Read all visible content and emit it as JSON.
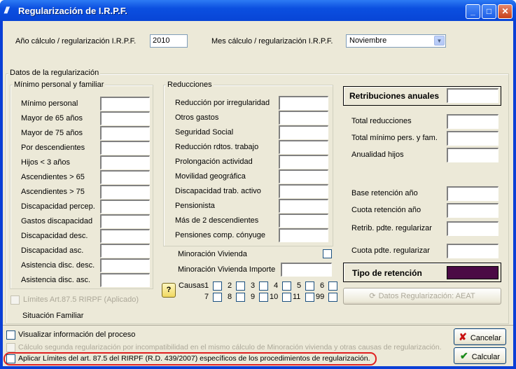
{
  "window": {
    "title": "Regularización de I.R.P.F.",
    "app_icon": "app-logo-icon"
  },
  "header": {
    "year_label": "Año cálculo / regularización I.R.P.F.",
    "year_value": "2010",
    "month_label": "Mes cálculo / regularización I.R.P.F.",
    "month_value": "Noviembre"
  },
  "datos_group": "Datos de la regularización",
  "minimo": {
    "title": "Mínimo personal y familiar",
    "items": [
      "Mínimo personal",
      "Mayor de 65 años",
      "Mayor de 75 años",
      "Por descendientes",
      "Hijos < 3 años",
      "Ascendientes > 65",
      "Ascendientes > 75",
      "Discapacidad percep.",
      "Gastos discapacidad",
      "Discapacidad desc.",
      "Discapacidad asc.",
      "Asistencia disc. desc.",
      "Asistencia disc. asc."
    ]
  },
  "reducciones": {
    "title": "Reducciones",
    "items": [
      "Reducción por irregularidad",
      "Otros gastos",
      "Seguridad Social",
      "Reducción rdtos. trabajo",
      "Prolongación actividad",
      "Movilidad geográfica",
      "Discapacidad trab. activo",
      "Pensionista",
      "Más de 2 descendientes",
      "Pensiones comp. cónyuge"
    ],
    "minoracion_vivienda": "Minoración Vivienda",
    "minoracion_importe": "Minoración Vivienda Importe",
    "causas_label": "Causas",
    "causas_row1": [
      "1",
      "2",
      "3",
      "4",
      "5",
      "6"
    ],
    "causas_row2": [
      "7",
      "8",
      "9",
      "10",
      "11",
      "99"
    ]
  },
  "right": {
    "retribuciones": "Retribuciones anuales",
    "items_top": [
      "Total reducciones",
      "Total mínimo pers. y fam.",
      "Anualidad hijos"
    ],
    "items_bottom": [
      "Base retención año",
      "Cuota retención año",
      "Retrib. pdte. regularizar",
      "Cuota pdte. regularizar"
    ],
    "tipo_retencion": "Tipo de retención",
    "tipo_color": "#4b0a45",
    "aeat_button": "Datos Regularización: AEAT"
  },
  "limites": "Límites Art.87.5 RIRPF (Aplicado)",
  "situacion": "Situación Familiar",
  "bottom": {
    "visualizar": "Visualizar información del proceso",
    "calculo_segunda": "Cálculo segunda regularización por incompatibilidad en el mismo cálculo de Minoración vivienda  y otras causas de regularización.",
    "aplicar": "Aplicar Límites del art. 87.5 del RIRPF (R.D. 439/2007) específicos de los procedimientos de regularización.",
    "highlight_color": "#e02020"
  },
  "buttons": {
    "cancelar": "Cancelar",
    "calcular": "Calcular"
  }
}
